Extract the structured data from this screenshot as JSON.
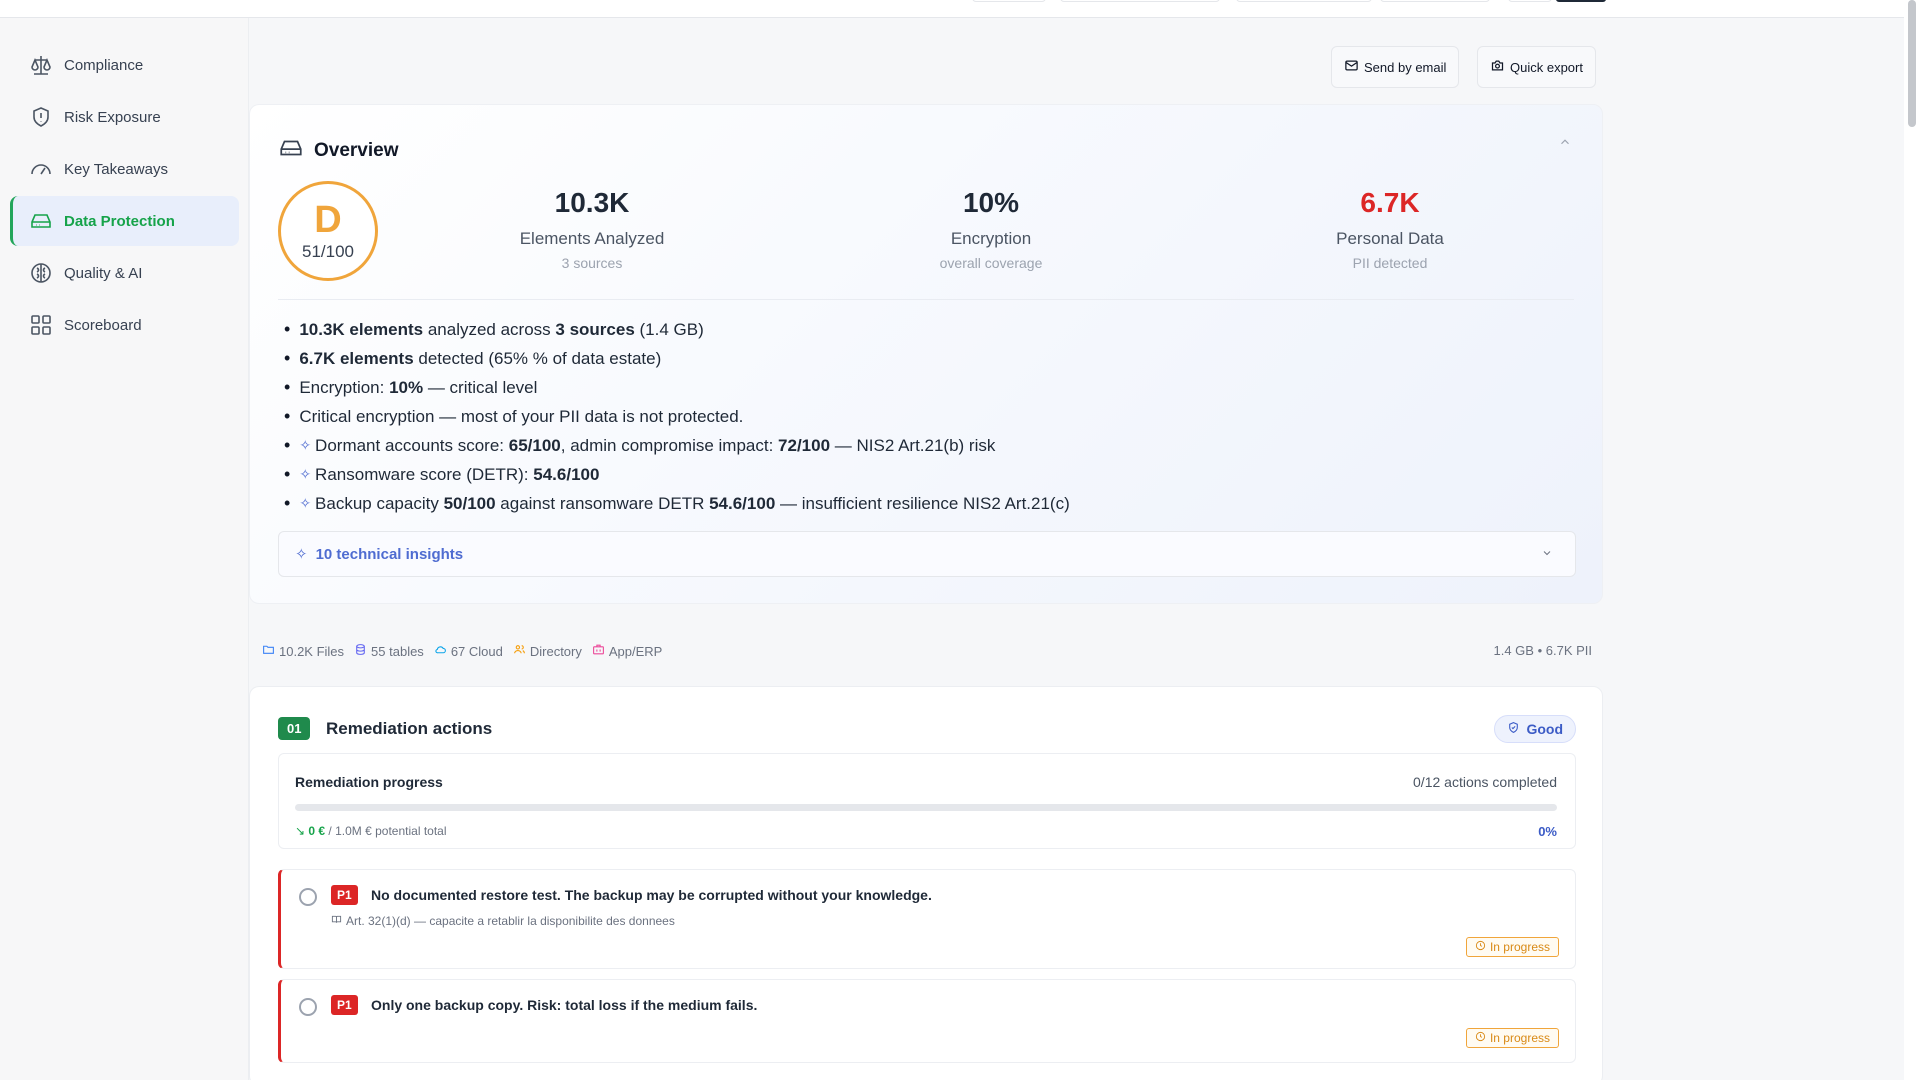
{
  "colors": {
    "accent_green": "#16a34a",
    "grade_orange": "#f0a53b",
    "danger_red": "#dc2626",
    "link_blue": "#4f6cd1"
  },
  "sidebar": {
    "items": [
      {
        "label": "Compliance",
        "icon": "scale-icon",
        "active": false
      },
      {
        "label": "Risk Exposure",
        "icon": "shield-icon",
        "active": false
      },
      {
        "label": "Key Takeaways",
        "icon": "gauge-icon",
        "active": false
      },
      {
        "label": "Data Protection",
        "icon": "drive-icon",
        "active": true
      },
      {
        "label": "Quality & AI",
        "icon": "brain-icon",
        "active": false
      },
      {
        "label": "Scoreboard",
        "icon": "grid-icon",
        "active": false
      }
    ]
  },
  "toolbar": {
    "send_email": "Send by email",
    "quick_export": "Quick export"
  },
  "overview": {
    "title": "Overview",
    "grade": {
      "letter": "D",
      "score": "51/100"
    },
    "stats": [
      {
        "value": "10.3K",
        "label": "Elements Analyzed",
        "sub": "3 sources"
      },
      {
        "value": "10%",
        "label": "Encryption",
        "sub": "overall coverage"
      },
      {
        "value": "6.7K",
        "label": "Personal Data",
        "sub": "PII detected"
      }
    ],
    "bullets": {
      "b1": {
        "strong1": "10.3K elements",
        "t1": " analyzed across ",
        "strong2": "3 sources",
        "t2": " (1.4 GB)"
      },
      "b2": {
        "strong1": "6.7K elements",
        "t1": " detected (65% % of data estate)"
      },
      "b3": {
        "t0": "Encryption: ",
        "strong1": "10%",
        "t1": " — critical level"
      },
      "b4": {
        "t0": "Critical encryption — most of your PII data is not protected."
      },
      "b5": {
        "t0": "Dormant accounts score: ",
        "strong1": "65/100",
        "t1": ", admin compromise impact: ",
        "strong2": "72/100",
        "t2": " — NIS2 Art.21(b) risk"
      },
      "b6": {
        "t0": "Ransomware score (DETR): ",
        "strong1": "54.6/100"
      },
      "b7": {
        "t0": "Backup capacity ",
        "strong1": "50/100",
        "t1": " against ransomware DETR ",
        "strong2": "54.6/100",
        "t2": " — insufficient resilience NIS2 Art.21(c)"
      }
    },
    "insights_label": "10 technical insights"
  },
  "sources": {
    "items": [
      {
        "label": "10.2K Files",
        "icon": "folder-icon",
        "color": "#3b82f6"
      },
      {
        "label": "55 tables",
        "icon": "database-icon",
        "color": "#6366f1"
      },
      {
        "label": "67 Cloud",
        "icon": "cloud-icon",
        "color": "#0ea5e9"
      },
      {
        "label": "Directory",
        "icon": "users-icon",
        "color": "#f59e0b"
      },
      {
        "label": "App/ERP",
        "icon": "app-icon",
        "color": "#ec4899"
      }
    ],
    "summary": "1.4 GB • 6.7K PII"
  },
  "remediation": {
    "number": "01",
    "title": "Remediation actions",
    "badge": "Good",
    "progress": {
      "title": "Remediation progress",
      "count": "0/12 actions completed",
      "fraction": 0,
      "money_value": "0 €",
      "money_rest": " / 1.0M € potential total",
      "percent": "0%"
    },
    "actions": [
      {
        "priority": "P1",
        "text": "No documented restore test. The backup may be corrupted without your knowledge.",
        "ref": "Art. 32(1)(d) — capacite a retablir la disponibilite des donnees",
        "status": "In progress"
      },
      {
        "priority": "P1",
        "text": "Only one backup copy. Risk: total loss if the medium fails.",
        "ref": "",
        "status": "In progress"
      }
    ]
  }
}
